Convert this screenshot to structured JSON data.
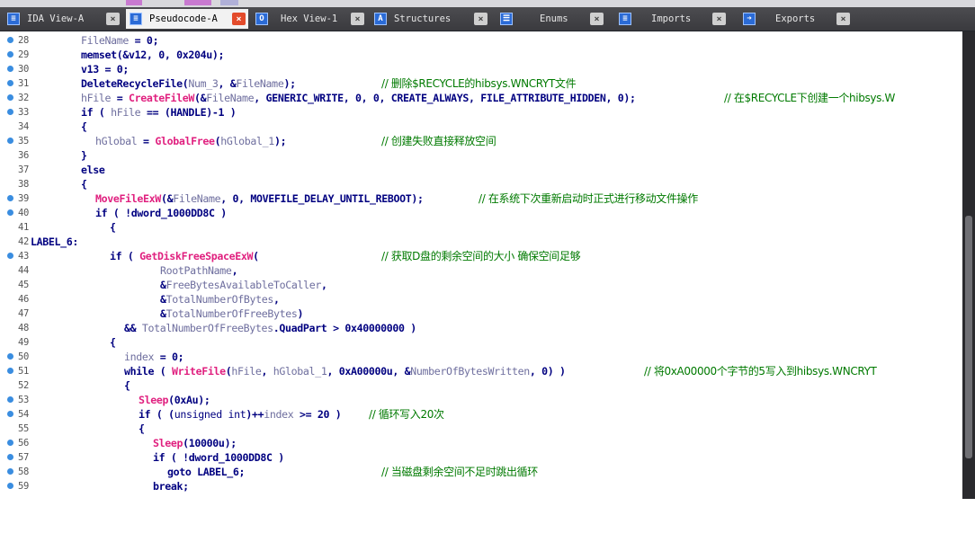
{
  "tabs": [
    {
      "label": "IDA View-A",
      "icon": "disassembly-icon",
      "active": false
    },
    {
      "label": "Pseudocode-A",
      "icon": "pseudocode-icon",
      "active": true
    },
    {
      "label": "Hex View-1",
      "icon": "hex-icon",
      "active": false
    },
    {
      "label": "Structures",
      "icon": "structures-icon",
      "active": false
    },
    {
      "label": "Enums",
      "icon": "enums-icon",
      "active": false
    },
    {
      "label": "Imports",
      "icon": "imports-icon",
      "active": false
    },
    {
      "label": "Exports",
      "icon": "exports-icon",
      "active": false
    }
  ],
  "close_glyph": "×",
  "icon_letters": {
    "hex": "O",
    "structures": "A"
  },
  "lines": [
    {
      "n": "28",
      "bp": true
    },
    {
      "n": "29",
      "bp": true
    },
    {
      "n": "30",
      "bp": true
    },
    {
      "n": "31",
      "bp": true
    },
    {
      "n": "32",
      "bp": true
    },
    {
      "n": "33",
      "bp": true
    },
    {
      "n": "34",
      "bp": false
    },
    {
      "n": "35",
      "bp": true
    },
    {
      "n": "36",
      "bp": false
    },
    {
      "n": "37",
      "bp": false
    },
    {
      "n": "38",
      "bp": false
    },
    {
      "n": "39",
      "bp": true
    },
    {
      "n": "40",
      "bp": true
    },
    {
      "n": "41",
      "bp": false
    },
    {
      "n": "42",
      "bp": false,
      "label": "LABEL_6:"
    },
    {
      "n": "43",
      "bp": true
    },
    {
      "n": "44",
      "bp": false
    },
    {
      "n": "45",
      "bp": false
    },
    {
      "n": "46",
      "bp": false
    },
    {
      "n": "47",
      "bp": false
    },
    {
      "n": "48",
      "bp": false
    },
    {
      "n": "49",
      "bp": false
    },
    {
      "n": "50",
      "bp": true
    },
    {
      "n": "51",
      "bp": true
    },
    {
      "n": "52",
      "bp": false
    },
    {
      "n": "53",
      "bp": true
    },
    {
      "n": "54",
      "bp": true
    },
    {
      "n": "55",
      "bp": false
    },
    {
      "n": "56",
      "bp": true
    },
    {
      "n": "57",
      "bp": true
    },
    {
      "n": "58",
      "bp": true
    },
    {
      "n": "59",
      "bp": true
    }
  ],
  "comments": {
    "c31": "// 删除$RECYCLE的hibsys.WNCRYT文件",
    "c32": "// 在$RECYCLE下创建一个hibsys.W",
    "c35": "// 创建失败直接释放空间",
    "c39": "// 在系统下次重新启动时正式进行移动文件操作",
    "c43": "// 获取D盘的剩余空间的大小 确保空间足够",
    "c51": "// 将0xA00000个字节的5写入到hibsys.WNCRYT",
    "c54": "// 循环写入20次",
    "c58": "// 当磁盘剩余空间不足时跳出循环"
  },
  "code": {
    "l28": {
      "a": "FileName",
      "b": " = 0;"
    },
    "l29": {
      "a": "memset(&v12, 0, 0x204u);"
    },
    "l30": {
      "a": "v13 = 0;"
    },
    "l31": {
      "f": "DeleteRecycleFile",
      "a": "(",
      "v1": "Num_3",
      "b": ", &",
      "v2": "FileName",
      "c": ");"
    },
    "l32": {
      "v0": "hFile",
      "a": " = ",
      "f": "CreateFileW",
      "b": "(&",
      "v1": "FileName",
      "c": ", GENERIC_WRITE, 0, 0, CREATE_ALWAYS, FILE_ATTRIBUTE_HIDDEN, 0);"
    },
    "l33": {
      "a": "if ( ",
      "v1": "hFile",
      "b": " == (HANDLE)-1 )"
    },
    "l34": {
      "a": "{"
    },
    "l35": {
      "v0": "hGlobal",
      "a": " = ",
      "f": "GlobalFree",
      "b": "(",
      "v1": "hGlobal_1",
      "c": ");"
    },
    "l36": {
      "a": "}"
    },
    "l37": {
      "a": "else"
    },
    "l38": {
      "a": "{"
    },
    "l39": {
      "f": "MoveFileExW",
      "a": "(&",
      "v1": "FileName",
      "b": ", 0, MOVEFILE_DELAY_UNTIL_REBOOT);"
    },
    "l40": {
      "a": "if ( !dword_1000DD8C )"
    },
    "l41": {
      "a": "{"
    },
    "l43": {
      "a": "if ( ",
      "f": "GetDiskFreeSpaceExW",
      "b": "("
    },
    "l44": {
      "v1": "RootPathName",
      "a": ","
    },
    "l45": {
      "a": "&",
      "v1": "FreeBytesAvailableToCaller",
      "b": ","
    },
    "l46": {
      "a": "&",
      "v1": "TotalNumberOfBytes",
      "b": ","
    },
    "l47": {
      "a": "&",
      "v1": "TotalNumberOfFreeBytes",
      "b": ")"
    },
    "l48": {
      "a": "&& ",
      "v1": "TotalNumberOfFreeBytes",
      "b": ".QuadPart > 0x40000000 )"
    },
    "l49": {
      "a": "{"
    },
    "l50": {
      "v0": "index",
      "a": " = 0;"
    },
    "l51": {
      "a": "while ( ",
      "f": "WriteFile",
      "b": "(",
      "v1": "hFile",
      "c": ", ",
      "v2": "hGlobal_1",
      "d": ", 0xA00000u, &",
      "v3": "NumberOfBytesWritten",
      "e": ", 0) )"
    },
    "l52": {
      "a": "{"
    },
    "l53": {
      "f": "Sleep",
      "a": "(0xAu);"
    },
    "l54": {
      "a": "if ( (",
      "t": "unsigned int",
      "b": ")++",
      "v1": "index",
      "c": " >= 20 )"
    },
    "l55": {
      "a": "{"
    },
    "l56": {
      "f": "Sleep",
      "a": "(10000u);"
    },
    "l57": {
      "a": "if ( !dword_1000DD8C )"
    },
    "l58": {
      "a": "goto LABEL_6;"
    },
    "l59": {
      "a": "break;"
    }
  }
}
